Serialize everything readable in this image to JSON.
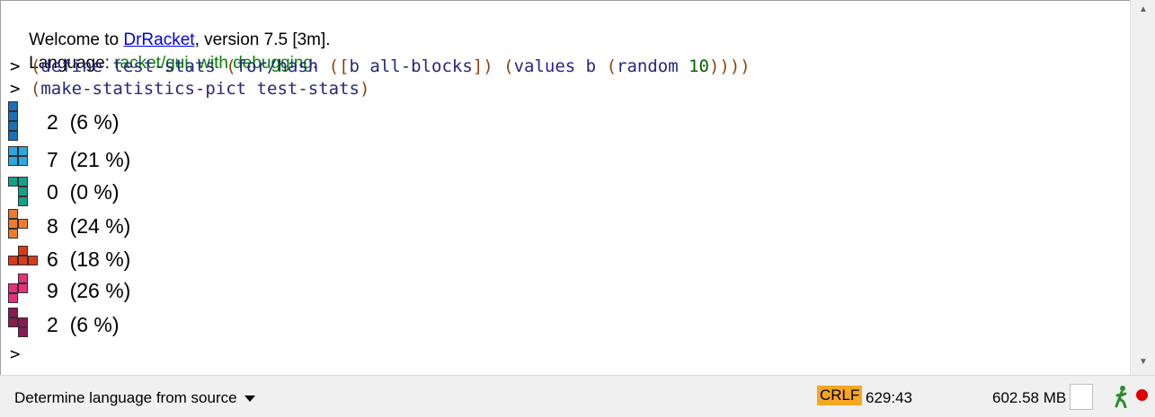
{
  "repl": {
    "welcome_prefix": "Welcome to ",
    "welcome_link": "DrRacket",
    "welcome_suffix": ", version 7.5 [3m].",
    "language_label": "Language: ",
    "language_value": "racket/gui, with debugging",
    "language_period": ".",
    "prompt": ">",
    "commands": [
      {
        "tokens": [
          {
            "t": "(",
            "k": "paren"
          },
          {
            "t": "define test-stats ",
            "k": "id"
          },
          {
            "t": "(",
            "k": "paren"
          },
          {
            "t": "for/hash ",
            "k": "id"
          },
          {
            "t": "([",
            "k": "paren"
          },
          {
            "t": "b all-blocks",
            "k": "id"
          },
          {
            "t": "]) ",
            "k": "paren"
          },
          {
            "t": "(",
            "k": "paren"
          },
          {
            "t": "values b ",
            "k": "id"
          },
          {
            "t": "(",
            "k": "paren"
          },
          {
            "t": "random ",
            "k": "id"
          },
          {
            "t": "10",
            "k": "num"
          },
          {
            "t": "))))",
            "k": "paren"
          }
        ]
      },
      {
        "tokens": [
          {
            "t": "(",
            "k": "paren"
          },
          {
            "t": "make-statistics-pict test-stats",
            "k": "id"
          },
          {
            "t": ")",
            "k": "paren"
          }
        ]
      }
    ],
    "stats": [
      {
        "block": "I",
        "color": "#1a70b8",
        "text": "2  (6 %)"
      },
      {
        "block": "O",
        "color": "#2aa8e0",
        "text": "7  (21 %)"
      },
      {
        "block": "J",
        "color": "#15a08a",
        "text": "0  (0 %)"
      },
      {
        "block": "L",
        "color": "#f07a30",
        "text": "8  (24 %)"
      },
      {
        "block": "T",
        "color": "#d83a1a",
        "text": "6  (18 %)"
      },
      {
        "block": "S",
        "color": "#e8307a",
        "text": "9  (26 %)"
      },
      {
        "block": "Z",
        "color": "#8a1a50",
        "text": "2  (6 %)"
      }
    ]
  },
  "statusbar": {
    "language_selector": "Determine language from source",
    "line_ending": "CRLF",
    "cursor_position": "629:43",
    "memory": "602.58 MB"
  }
}
